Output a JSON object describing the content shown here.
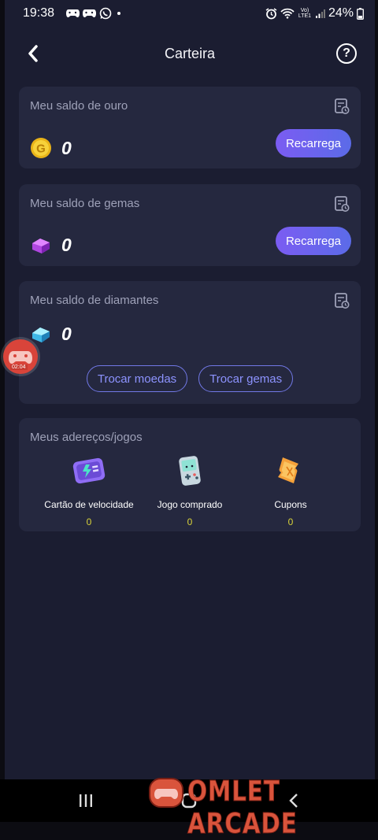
{
  "status_bar": {
    "time": "19:38",
    "signal_label": "Vo) LTE1",
    "battery": "24%"
  },
  "header": {
    "title": "Carteira"
  },
  "gold": {
    "label": "Meu saldo de ouro",
    "coin_letter": "G",
    "amount": "0",
    "button": "Recarrega"
  },
  "gems": {
    "label": "Meu saldo de gemas",
    "amount": "0",
    "button": "Recarrega"
  },
  "diamonds": {
    "label": "Meu saldo de diamantes",
    "amount": "0",
    "exchange_coins": "Trocar moedas",
    "exchange_gems": "Trocar gemas"
  },
  "props": {
    "label": "Meus adereços/jogos",
    "items": [
      {
        "label": "Cartão de velocidade",
        "count": "0",
        "icon": "speed-card-icon"
      },
      {
        "label": "Jogo comprado",
        "count": "0",
        "icon": "game-console-icon"
      },
      {
        "label": "Cupons",
        "count": "0",
        "icon": "coupon-ticket-icon"
      }
    ]
  },
  "overlay": {
    "record_time": "02:04",
    "watermark": "OMLET ARCADE"
  },
  "colors": {
    "background": "#1b1d31",
    "card": "#25283f",
    "accent": "#7b5cf2",
    "count": "#d9d33a"
  }
}
